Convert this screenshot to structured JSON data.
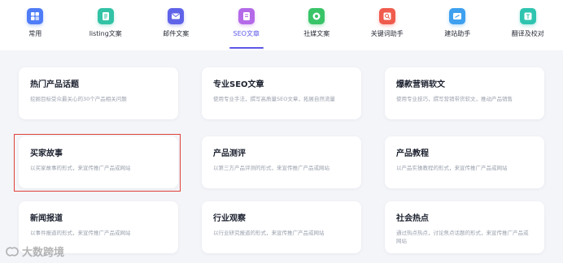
{
  "tabs": [
    {
      "label": "常用",
      "icon": "grid-icon",
      "color": "#4f7cf7",
      "active": false
    },
    {
      "label": "listing文案",
      "icon": "list-doc-icon",
      "color": "#32c2a5",
      "active": false
    },
    {
      "label": "邮件文案",
      "icon": "mail-icon",
      "color": "#5f63e8",
      "active": false
    },
    {
      "label": "SEO文章",
      "icon": "seo-doc-icon",
      "color": "#b46ae8",
      "active": true
    },
    {
      "label": "社媒文案",
      "icon": "social-icon",
      "color": "#39c468",
      "active": false
    },
    {
      "label": "关键词助手",
      "icon": "keyword-icon",
      "color": "#ef5b4d",
      "active": false
    },
    {
      "label": "建站助手",
      "icon": "website-icon",
      "color": "#3ea0ef",
      "active": false
    },
    {
      "label": "翻译及校对",
      "icon": "translate-icon",
      "color": "#2fc4b0",
      "active": false
    }
  ],
  "cards": [
    {
      "title": "热门产品话题",
      "desc": "挖掘目标受众最关心的30个产品相关问题"
    },
    {
      "title": "专业SEO文章",
      "desc": "使用专业手法，撰写高质量SEO文章，拓展自然流量"
    },
    {
      "title": "爆款营销软文",
      "desc": "使用专业技巧，撰写营销带货软文，推动产品销售"
    },
    {
      "title": "买家故事",
      "desc": "以买家故事的形式，来宣传推广产品或网站"
    },
    {
      "title": "产品测评",
      "desc": "以第三方产品评测的形式，来宣传推广产品或网站"
    },
    {
      "title": "产品教程",
      "desc": "以产品实操教程的形式，来宣传推广产品或网站"
    },
    {
      "title": "新闻报道",
      "desc": "以事件报道的形式，来宣传推广产品或网站"
    },
    {
      "title": "行业观察",
      "desc": "以行业研究报道的形式，来宣传推广产品或网站"
    },
    {
      "title": "社会热点",
      "desc": "通过热点热点，讨论焦点话题的形式，来宣传推广产品或网站"
    }
  ],
  "watermark": {
    "text": "大数跨境"
  },
  "colors": {
    "accent": "#5b57e8",
    "highlight_border": "#e0403a"
  }
}
